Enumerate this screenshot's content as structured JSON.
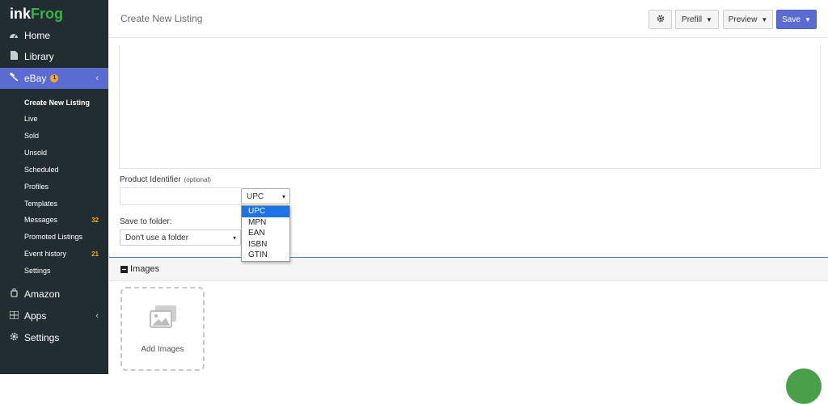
{
  "brand": {
    "part1": "ink",
    "part2": "Frog"
  },
  "sidebar": {
    "main_items": [
      {
        "label": "Home",
        "icon": "dashboard-icon"
      },
      {
        "label": "Library",
        "icon": "file-icon"
      },
      {
        "label": "eBay",
        "icon": "gavel-icon",
        "badge": "1",
        "chevron": "‹"
      }
    ],
    "ebay_subitems": [
      {
        "label": "Create New Listing"
      },
      {
        "label": "Live"
      },
      {
        "label": "Sold"
      },
      {
        "label": "Unsold"
      },
      {
        "label": "Scheduled"
      },
      {
        "label": "Profiles"
      },
      {
        "label": "Templates"
      },
      {
        "label": "Messages",
        "count": "32"
      },
      {
        "label": "Promoted Listings"
      },
      {
        "label": "Event history",
        "count": "21"
      },
      {
        "label": "Settings"
      }
    ],
    "lower_items": [
      {
        "label": "Amazon",
        "icon": "amazon-icon"
      },
      {
        "label": "Apps",
        "icon": "apps-icon",
        "chevron": "‹"
      },
      {
        "label": "Settings",
        "icon": "gear-icon"
      }
    ]
  },
  "header": {
    "title": "Create New Listing",
    "settings_icon": "gear-icon",
    "prefill_label": "Prefill",
    "preview_label": "Preview",
    "save_label": "Save"
  },
  "form": {
    "product_identifier": {
      "label": "Product Identifier",
      "optional": "(optional)",
      "value": "",
      "type_selected": "UPC",
      "type_options": [
        "UPC",
        "MPN",
        "EAN",
        "ISBN",
        "GTIN"
      ]
    },
    "save_to_folder": {
      "label": "Save to folder:",
      "selected": "Don't use a folder"
    }
  },
  "images_section": {
    "title": "Images",
    "add_label": "Add Images"
  },
  "colors": {
    "sidebar_bg": "#222d32",
    "accent": "#5a6bd1",
    "badge": "#f0ad2a",
    "brand_green": "#37b34a",
    "dropdown_highlight": "#1e74e6"
  }
}
